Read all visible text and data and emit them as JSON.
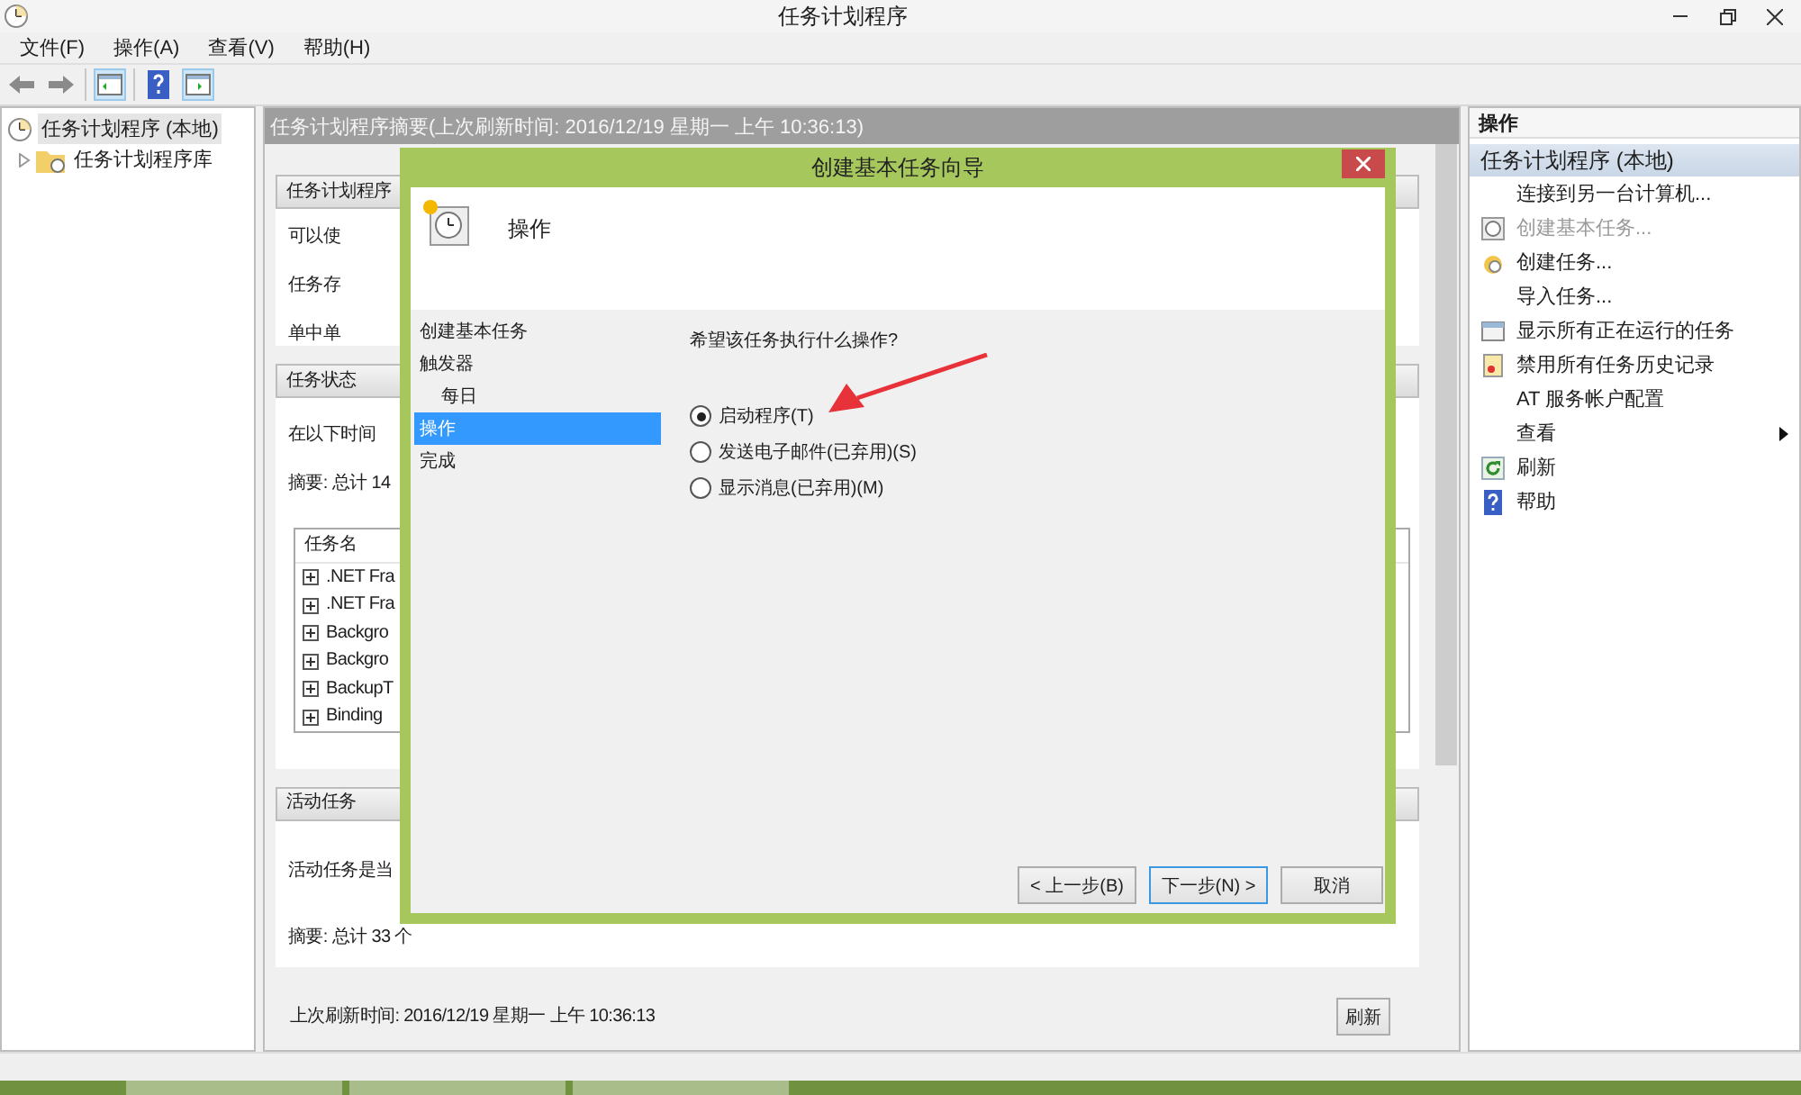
{
  "window": {
    "title": "任务计划程序"
  },
  "menu": [
    "文件(F)",
    "操作(A)",
    "查看(V)",
    "帮助(H)"
  ],
  "tree": {
    "label": "任务计划程序 (本地)",
    "selected": true,
    "children": [
      {
        "label": "任务计划程序库",
        "expanded": false
      }
    ]
  },
  "summary": {
    "header": "任务计划程序摘要(上次刷新时间: 2016/12/19 星期一 上午 10:36:13)",
    "sections": [
      {
        "title": "任务计划程序",
        "lines": [
          "可以使",
          "任务存",
          "单中单"
        ]
      },
      {
        "title": "任务状态",
        "lines": [
          "在以下时间",
          "摘要: 总计 14"
        ],
        "table": {
          "column": "任务名",
          "rows": [
            ".NET Fra",
            ".NET Fra",
            "Backgro",
            "Backgro",
            "BackupT",
            "Binding"
          ]
        }
      },
      {
        "title": "活动任务",
        "lines": [
          "活动任务是当",
          "摘要: 总计 33 个"
        ]
      }
    ],
    "refreshed": "上次刷新时间: 2016/12/19 星期一 上午 10:36:13",
    "refresh_button": "刷新"
  },
  "wizard": {
    "title": "创建基本任务向导",
    "heading": "操作",
    "steps": [
      {
        "label": "创建基本任务",
        "selected": false
      },
      {
        "label": "触发器",
        "selected": false,
        "children": [
          {
            "label": "每日",
            "selected": false
          }
        ]
      },
      {
        "label": "操作",
        "selected": true
      },
      {
        "label": "完成",
        "selected": false
      }
    ],
    "question": "希望该任务执行什么操作?",
    "options": [
      {
        "label": "启动程序(T)",
        "selected": true
      },
      {
        "label": "发送电子邮件(已弃用)(S)",
        "selected": false
      },
      {
        "label": "显示消息(已弃用)(M)",
        "selected": false
      }
    ],
    "buttons": [
      {
        "label": "< 上一步(B)",
        "focused": false
      },
      {
        "label": "下一步(N) >",
        "focused": true
      },
      {
        "label": "取消",
        "focused": false
      }
    ]
  },
  "actions": {
    "header": "操作",
    "group": "任务计划程序 (本地)",
    "items": [
      {
        "label": "连接到另一台计算机...",
        "kind": "plain",
        "disabled": false
      },
      {
        "label": "创建基本任务...",
        "kind": "wizard",
        "disabled": true
      },
      {
        "label": "创建任务...",
        "kind": "task",
        "disabled": false
      },
      {
        "label": "导入任务...",
        "kind": "plain",
        "disabled": false
      },
      {
        "label": "显示所有正在运行的任务",
        "kind": "running",
        "disabled": false
      },
      {
        "label": "禁用所有任务历史记录",
        "kind": "history",
        "disabled": false
      },
      {
        "label": "AT 服务帐户配置",
        "kind": "plain",
        "disabled": false
      },
      {
        "label": "查看",
        "kind": "submenu",
        "disabled": false
      },
      {
        "label": "刷新",
        "kind": "refresh",
        "disabled": false
      },
      {
        "label": "帮助",
        "kind": "help",
        "disabled": false
      }
    ]
  }
}
